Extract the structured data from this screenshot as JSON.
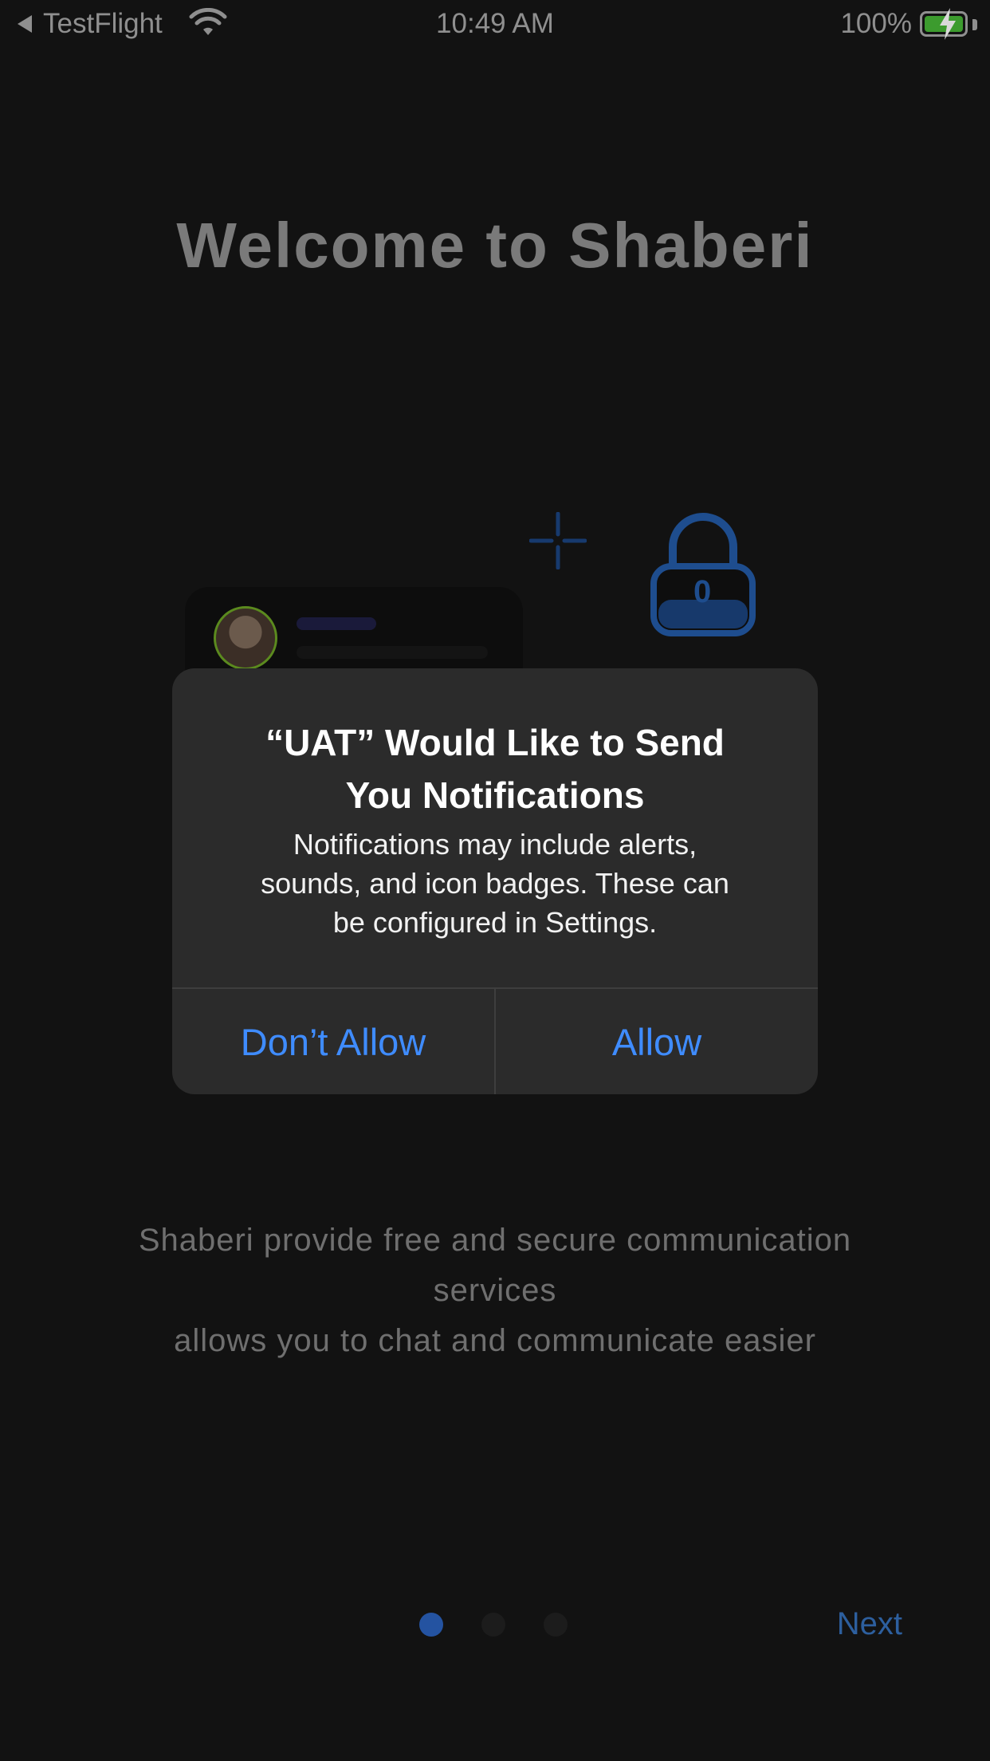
{
  "status_bar": {
    "back_app": "TestFlight",
    "time": "10:49 AM",
    "battery_percent": "100%",
    "icons": [
      "back-triangle-icon",
      "wifi-icon",
      "battery-icon",
      "charging-bolt-icon"
    ]
  },
  "onboarding": {
    "title": "Welcome to Shaberi",
    "lock_counter": "0",
    "description_lines": [
      "Shaberi provide free and secure communication",
      "services",
      "allows you to chat and communicate easier"
    ],
    "pages": 3,
    "active_page": 1,
    "next_label": "Next"
  },
  "alert": {
    "title_line1": "“UAT” Would Like to Send",
    "title_line2": "You Notifications",
    "message_line1": "Notifications may include alerts,",
    "message_line2": "sounds, and icon badges. These can",
    "message_line3": "be configured in Settings.",
    "deny_label": "Don’t Allow",
    "allow_label": "Allow"
  },
  "colors": {
    "background": "#121212",
    "alert_background": "#2b2b2b",
    "alert_button": "#3f8cff",
    "accent_blue": "#2453a1"
  }
}
